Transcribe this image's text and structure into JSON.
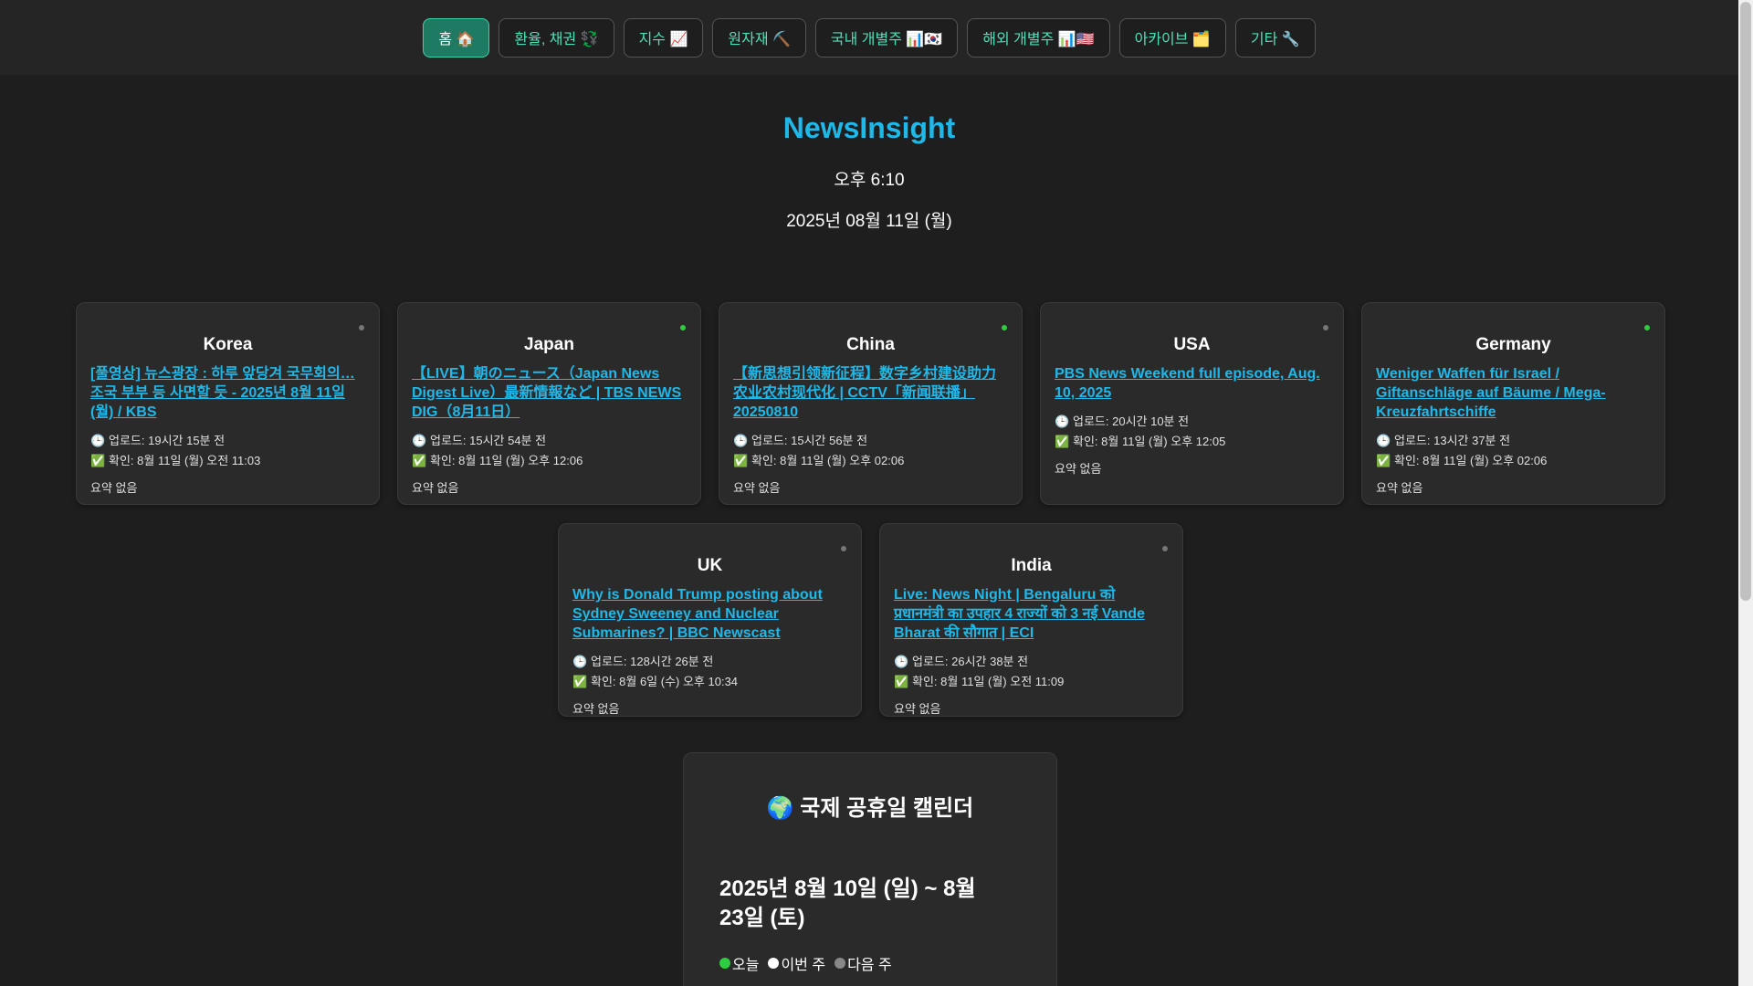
{
  "nav": {
    "items": [
      {
        "label": "홈 🏠",
        "active": true
      },
      {
        "label": "환율, 채권 💱",
        "active": false
      },
      {
        "label": "지수 📈",
        "active": false
      },
      {
        "label": "원자재 ⛏️",
        "active": false
      },
      {
        "label": "국내 개별주 📊🇰🇷",
        "active": false
      },
      {
        "label": "해외 개별주 📊🇺🇸",
        "active": false
      },
      {
        "label": "아카이브 🗂️",
        "active": false
      },
      {
        "label": "기타 🔧",
        "active": false
      }
    ]
  },
  "header": {
    "title": "NewsInsight",
    "time": "오후 6:10",
    "date": "2025년 08월 11일 (월)"
  },
  "colors": {
    "accent": "#1fb8e8",
    "nav_text": "#4fe0b8",
    "nav_active_bg": "#1f7a63",
    "dot_green": "#2ecc40",
    "dot_gray": "#777777"
  },
  "cards": [
    {
      "country": "Korea",
      "dot": "gray",
      "title": "[풀영상] 뉴스광장 : 하루 앞당겨 국무회의…조국 부부 등 사면할 듯 - 2025년 8월 11일(월) / KBS",
      "upload": "업로드: 19시간 15분 전",
      "checked": "확인: 8월 11일 (월) 오전 11:03",
      "summary": "요약 없음"
    },
    {
      "country": "Japan",
      "dot": "green",
      "title": "【LIVE】朝のニュース（Japan News Digest Live）最新情報など | TBS NEWS DIG（8月11日）",
      "upload": "업로드: 15시간 54분 전",
      "checked": "확인: 8월 11일 (월) 오후 12:06",
      "summary": "요약 없음"
    },
    {
      "country": "China",
      "dot": "green",
      "title": "【新思想引领新征程】数字乡村建设助力农业农村现代化 | CCTV「新闻联播」20250810",
      "upload": "업로드: 15시간 56분 전",
      "checked": "확인: 8월 11일 (월) 오후 02:06",
      "summary": "요약 없음"
    },
    {
      "country": "USA",
      "dot": "gray",
      "title": "PBS News Weekend full episode, Aug. 10, 2025",
      "upload": "업로드: 20시간 10분 전",
      "checked": "확인: 8월 11일 (월) 오후 12:05",
      "summary": "요약 없음"
    },
    {
      "country": "Germany",
      "dot": "green",
      "title": "Weniger Waffen für Israel / Giftanschläge auf Bäume / Mega-Kreuzfahrtschiffe",
      "upload": "업로드: 13시간 37분 전",
      "checked": "확인: 8월 11일 (월) 오후 02:06",
      "summary": "요약 없음"
    },
    {
      "country": "UK",
      "dot": "gray",
      "title": "Why is Donald Trump posting about Sydney Sweeney and Nuclear Submarines? | BBC Newscast",
      "upload": "업로드: 128시간 26분 전",
      "checked": "확인: 8월 6일 (수) 오후 10:34",
      "summary": "요약 없음"
    },
    {
      "country": "India",
      "dot": "gray",
      "title": "Live: News Night | Bengaluru को प्रधानमंत्री का उपहार 4 राज्यों को 3 नई Vande Bharat की सौगात | ECI",
      "upload": "업로드: 26시간 38분 전",
      "checked": "확인: 8월 11일 (월) 오전 11:09",
      "summary": "요약 없음"
    }
  ],
  "icons": {
    "upload": "clock-icon 🕒",
    "checked": "check-icon ✅"
  },
  "calendar": {
    "title": "🌍 국제 공휴일 캘린더",
    "range": "2025년 8월 10일 (일) ~ 8월 23일 (토)",
    "legend": [
      {
        "label": "오늘",
        "color": "#2ecc40"
      },
      {
        "label": "이번 주",
        "color": "#ffffff"
      },
      {
        "label": "다음 주",
        "color": "#888888"
      }
    ]
  }
}
